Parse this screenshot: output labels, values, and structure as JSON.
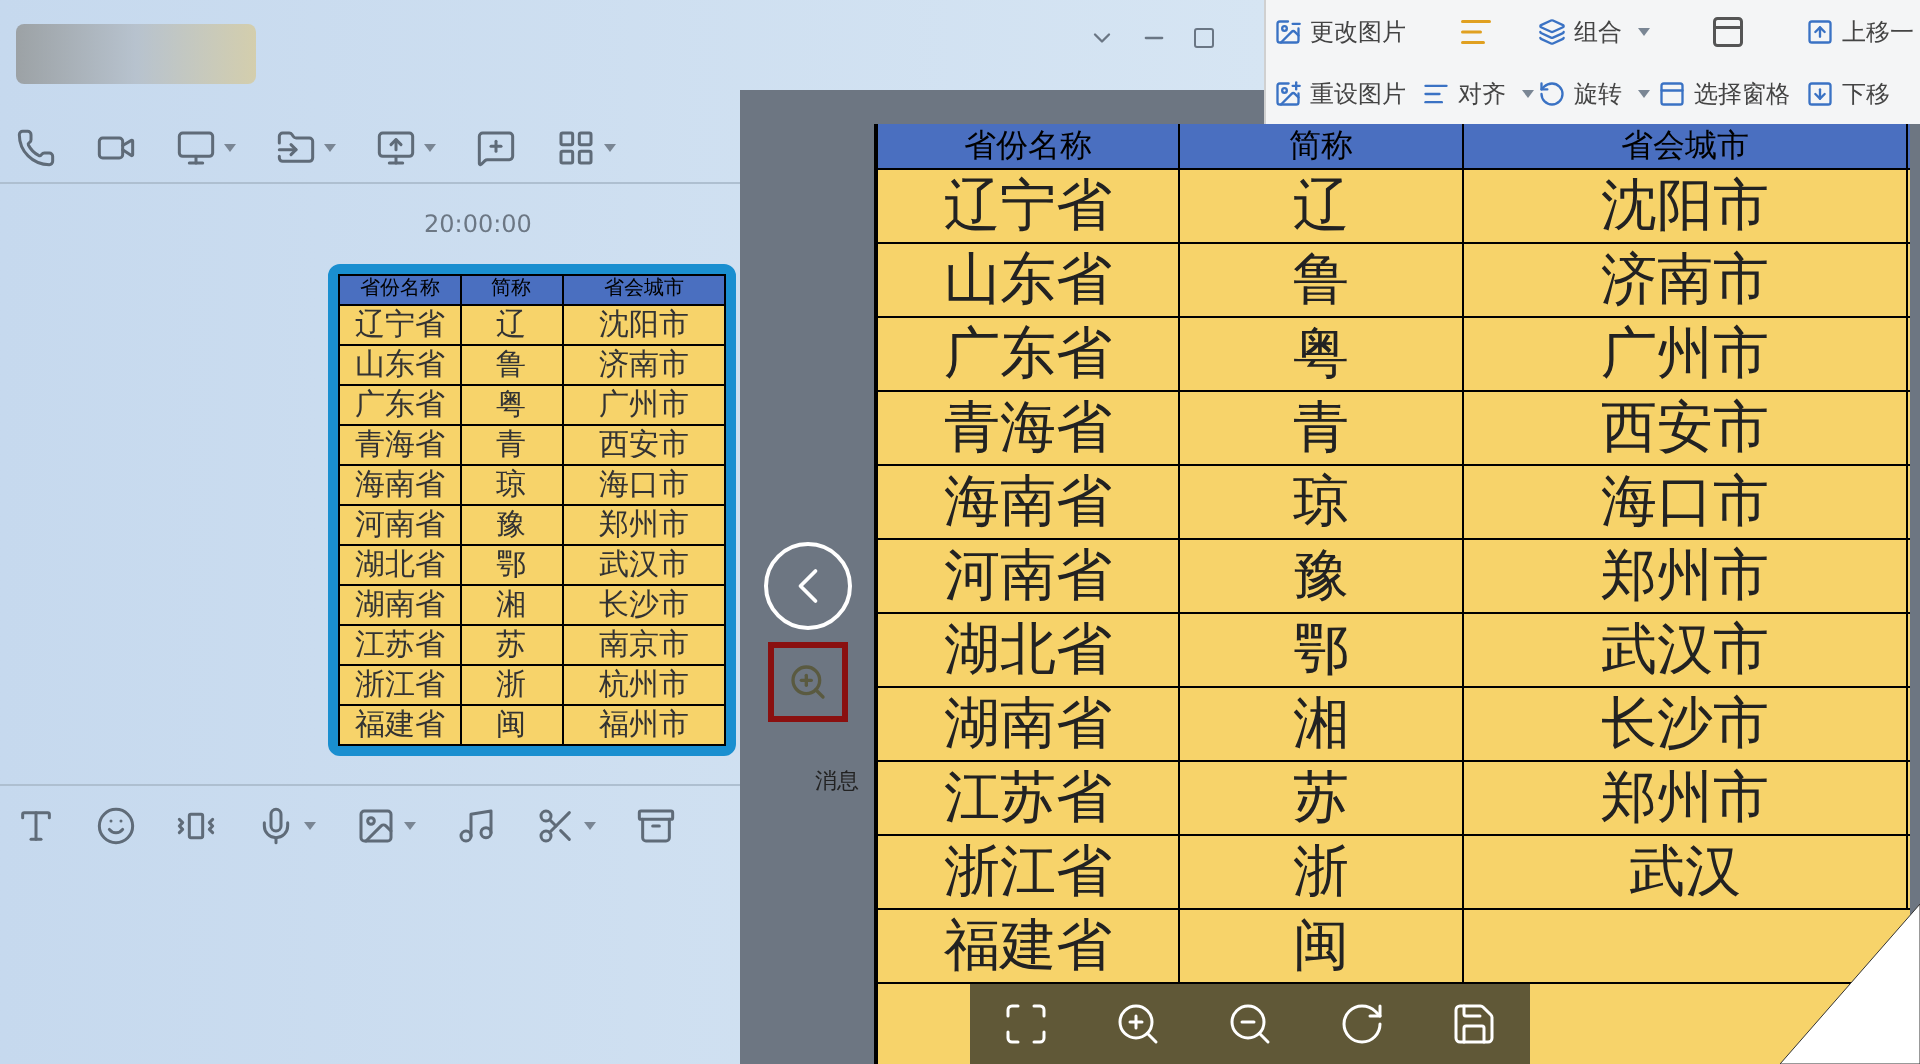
{
  "chat": {
    "timestamp": "20:00:00",
    "side_label": "消息",
    "image_table": {
      "columns": [
        "省份名称",
        "简称",
        "省会城市"
      ],
      "rows": [
        [
          "辽宁省",
          "辽",
          "沈阳市"
        ],
        [
          "山东省",
          "鲁",
          "济南市"
        ],
        [
          "广东省",
          "粤",
          "广州市"
        ],
        [
          "青海省",
          "青",
          "西安市"
        ],
        [
          "海南省",
          "琼",
          "海口市"
        ],
        [
          "河南省",
          "豫",
          "郑州市"
        ],
        [
          "湖北省",
          "鄂",
          "武汉市"
        ],
        [
          "湖南省",
          "湘",
          "长沙市"
        ],
        [
          "江苏省",
          "苏",
          "南京市"
        ],
        [
          "浙江省",
          "浙",
          "杭州市"
        ],
        [
          "福建省",
          "闽",
          "福州市"
        ]
      ]
    }
  },
  "ribbon": {
    "items": [
      {
        "label": "更改图片"
      },
      {
        "label": "组合",
        "dropdown": true
      },
      {
        "label": "上移一"
      },
      {
        "label": "重设图片"
      },
      {
        "label": "对齐",
        "dropdown": true
      },
      {
        "label": "旋转",
        "dropdown": true
      },
      {
        "label": "选择窗格"
      },
      {
        "label": "下移"
      }
    ]
  },
  "viewer": {
    "table": {
      "columns": [
        "省份名称",
        "简称",
        "省会城市"
      ],
      "rows": [
        [
          "辽宁省",
          "辽",
          "沈阳市"
        ],
        [
          "山东省",
          "鲁",
          "济南市"
        ],
        [
          "广东省",
          "粤",
          "广州市"
        ],
        [
          "青海省",
          "青",
          "西安市"
        ],
        [
          "海南省",
          "琼",
          "海口市"
        ],
        [
          "河南省",
          "豫",
          "郑州市"
        ],
        [
          "湖北省",
          "鄂",
          "武汉市"
        ],
        [
          "湖南省",
          "湘",
          "长沙市"
        ],
        [
          "江苏省",
          "苏",
          "郑州市"
        ],
        [
          "浙江省",
          "浙",
          "武汉"
        ],
        [
          "福建省",
          "闽"
        ]
      ]
    }
  }
}
